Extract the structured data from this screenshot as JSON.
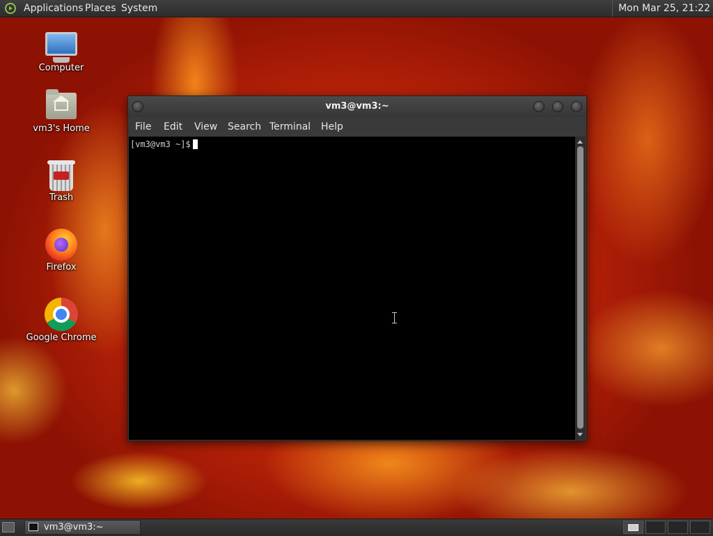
{
  "top_panel": {
    "menus": [
      "Applications",
      "Places",
      "System"
    ],
    "clock": "Mon Mar 25, 21:22"
  },
  "desktop": {
    "icons": [
      {
        "label": "Computer",
        "icon": "computer-icon"
      },
      {
        "label": "vm3's Home",
        "icon": "home-folder-icon"
      },
      {
        "label": "Trash",
        "icon": "trash-icon"
      },
      {
        "label": "Firefox",
        "icon": "firefox-icon"
      },
      {
        "label": "Google Chrome",
        "icon": "chrome-icon"
      }
    ]
  },
  "terminal": {
    "title": "vm3@vm3:~",
    "menu": [
      "File",
      "Edit",
      "View",
      "Search",
      "Terminal",
      "Help"
    ],
    "prompt": "[vm3@vm3 ~]$"
  },
  "taskbar": {
    "task_label": "vm3@vm3:~"
  },
  "colors": {
    "panel": "#2c2c2c",
    "terminal_bg": "#000000",
    "wallpaper": "#c2260a"
  }
}
